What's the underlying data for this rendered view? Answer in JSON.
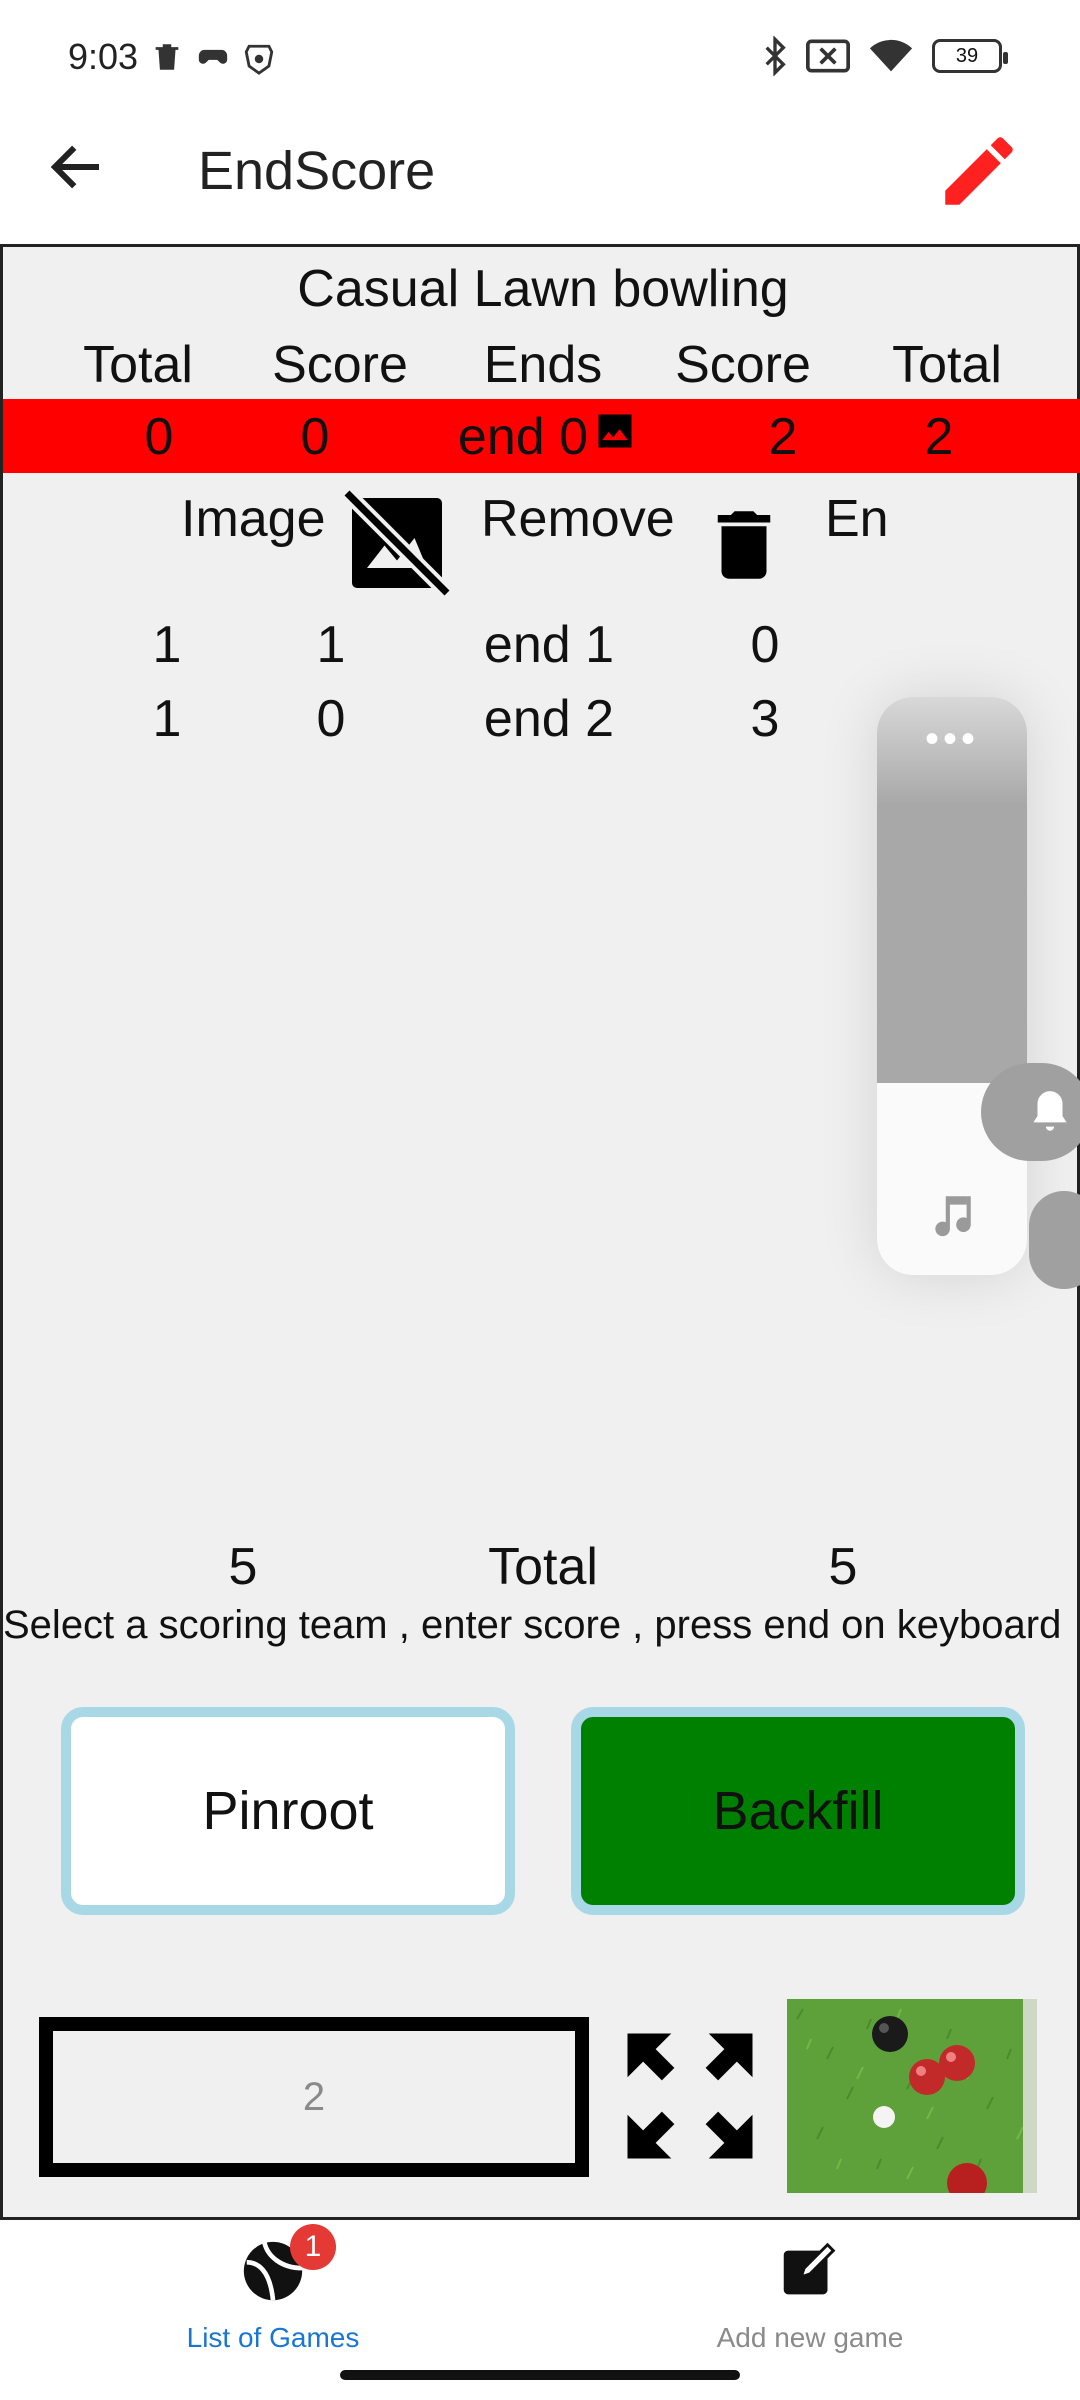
{
  "status_bar": {
    "time": "9:03",
    "battery": "39"
  },
  "app_bar": {
    "title": "EndScore"
  },
  "game": {
    "title": "Casual Lawn bowling",
    "headers": [
      "Total",
      "Score",
      "Ends",
      "Score",
      "Total"
    ],
    "current_row": {
      "left_total": "0",
      "left_score": "0",
      "end": "end 0",
      "right_score": "2",
      "right_total": "2"
    },
    "image_row": {
      "image_label": "Image",
      "remove_label": "Remove",
      "extra_label": "En"
    },
    "rows": [
      {
        "left_total": "1",
        "left_score": "1",
        "end": "end 1",
        "right_score": "0"
      },
      {
        "left_total": "1",
        "left_score": "0",
        "end": "end 2",
        "right_score": "3"
      }
    ],
    "totals": {
      "left": "5",
      "label": "Total",
      "right": "5"
    },
    "instructions": "Select a scoring team , enter score , press end on keyboard"
  },
  "teams": {
    "left": "Pinroot",
    "right": "Backfill"
  },
  "score_input": {
    "value": "2"
  },
  "bottom_nav": {
    "items": [
      {
        "label": "List of Games",
        "badge": "1",
        "color": "#1976d2"
      },
      {
        "label": "Add new game",
        "color": "#8a8a8a"
      }
    ]
  },
  "colors": {
    "current_row": "#ff0000",
    "accent_edit": "#ff2020",
    "backfill": "#008000",
    "team_border": "#a8d8e6"
  }
}
